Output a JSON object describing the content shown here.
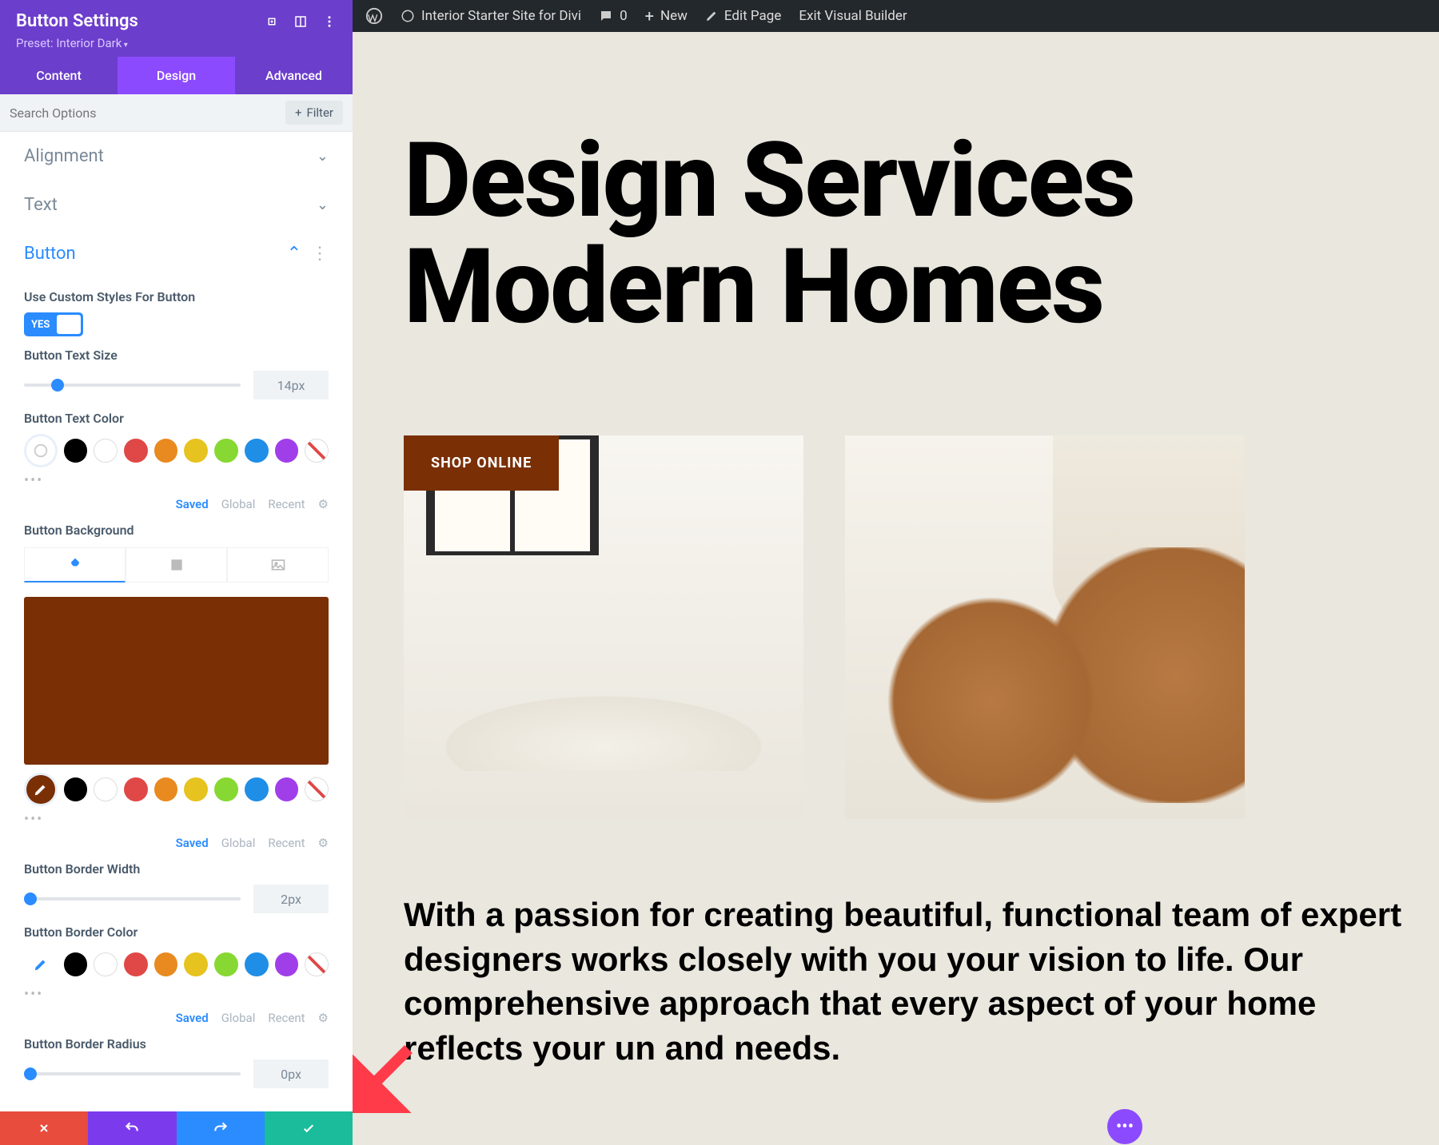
{
  "sidebar": {
    "title": "Button Settings",
    "preset": "Preset: Interior Dark",
    "tabs": {
      "content": "Content",
      "design": "Design",
      "advanced": "Advanced"
    },
    "search_placeholder": "Search Options",
    "filter": "Filter",
    "accordions": {
      "alignment": "Alignment",
      "text": "Text",
      "button": "Button"
    },
    "labels": {
      "custom_styles": "Use Custom Styles For Button",
      "toggle_yes": "YES",
      "text_size": "Button Text Size",
      "text_size_val": "14px",
      "text_color": "Button Text Color",
      "background": "Button Background",
      "border_width": "Button Border Width",
      "border_width_val": "2px",
      "border_color": "Button Border Color",
      "border_radius": "Button Border Radius",
      "border_radius_val": "0px",
      "saved": "Saved",
      "global": "Global",
      "recent": "Recent"
    },
    "colors": {
      "bg_preview": "#7a2f04"
    }
  },
  "wpbar": {
    "site": "Interior Starter Site for Divi",
    "comments": "0",
    "new": "New",
    "edit": "Edit Page",
    "exit": "Exit Visual Builder"
  },
  "page": {
    "hero_l1": "Design Services",
    "hero_l2": "Modern Homes",
    "shop": "SHOP ONLINE",
    "desc": "With a passion for creating beautiful, functional team of expert designers works closely with you your vision to life. Our comprehensive approach that every aspect of your home reflects your un and needs."
  }
}
